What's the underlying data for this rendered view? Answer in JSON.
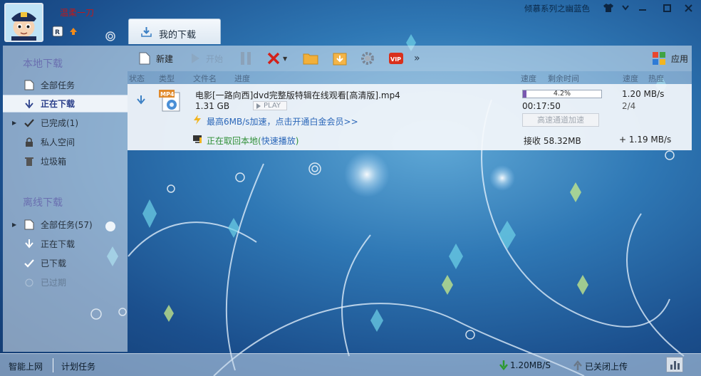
{
  "window": {
    "theme_name": "倾慕系列之幽蓝色",
    "username": "温柔一刀"
  },
  "tab": {
    "label": "我的下载"
  },
  "sidebar": {
    "local_title": "本地下载",
    "local_items": [
      {
        "label": "全部任务",
        "icon": "document-icon"
      },
      {
        "label": "正在下载",
        "icon": "download-arrow-icon"
      },
      {
        "label": "已完成(1)",
        "icon": "checkmark-icon"
      },
      {
        "label": "私人空间",
        "icon": "lock-icon"
      },
      {
        "label": "垃圾箱",
        "icon": "trash-icon"
      }
    ],
    "offline_title": "离线下载",
    "offline_items": [
      {
        "label": "全部任务(57)",
        "icon": "document-icon"
      },
      {
        "label": "正在下载",
        "icon": "download-arrow-icon"
      },
      {
        "label": "已下载",
        "icon": "checkmark-icon"
      },
      {
        "label": "已过期",
        "icon": "expired-icon"
      }
    ]
  },
  "toolbar": {
    "new_label": "新建",
    "start_label": "开始",
    "apps_label": "应用",
    "vip_label": "VIP"
  },
  "columns": [
    "状态",
    "类型",
    "文件名",
    "进度",
    "速度",
    "剩余时间",
    "速度",
    "热度"
  ],
  "task": {
    "filename": "电影[一路向西]dvd完整版特辑在线观看[高清版].mp4",
    "size": "1.31 GB",
    "play_label": "PLAY",
    "file_badge": "MP4",
    "progress_text": "4.2%",
    "progress_value": 4.2,
    "remaining_time": "00:17:50",
    "speed": "1.20 MB/s",
    "peers": "2/4",
    "accel_link": "最高6MB/s加速，点击开通白金会员>>",
    "accel_button": "高速通道加速",
    "status_text": "正在取回本地(",
    "fast_play_link": "快速播放",
    "status_close": ")",
    "received": "接收 58.32MB",
    "received_speed": "+ 1.19 MB/s"
  },
  "statusbar": {
    "smart_upload": "智能上网",
    "schedule": "计划任务",
    "down_speed": "1.20MB/S",
    "upload_status": "已关闭上传"
  },
  "colors": {
    "accent": "#7a58b0",
    "link": "#2a66b8",
    "section_title": "#6a6fb0",
    "username": "#c21818"
  }
}
